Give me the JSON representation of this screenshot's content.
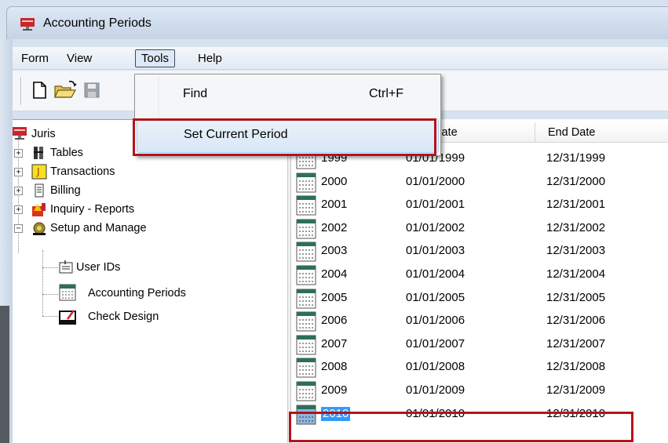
{
  "window": {
    "title": "Accounting Periods",
    "app_icon": "juris-app-icon"
  },
  "menubar": {
    "items": [
      {
        "label": "Form"
      },
      {
        "label": "View"
      },
      {
        "label": "Tools",
        "active": true
      },
      {
        "label": "Help"
      }
    ]
  },
  "toolbar": {
    "buttons": [
      {
        "icon": "new-document-icon"
      },
      {
        "icon": "open-folder-icon"
      },
      {
        "icon": "save-disk-icon",
        "disabled": true
      }
    ]
  },
  "tools_menu": {
    "items": [
      {
        "label": "Find",
        "shortcut": "Ctrl+F"
      },
      {
        "label": "Set Current Period",
        "shortcut": "",
        "highlighted": true
      }
    ]
  },
  "tree": {
    "root": "Juris",
    "nodes": [
      {
        "label": "Tables",
        "expander": "+"
      },
      {
        "label": "Transactions",
        "expander": "+"
      },
      {
        "label": "Billing",
        "expander": "+"
      },
      {
        "label": "Inquiry - Reports",
        "expander": "+"
      },
      {
        "label": "Setup and Manage",
        "expander": "−"
      }
    ],
    "children": [
      {
        "label": "User IDs"
      },
      {
        "label": "Accounting Periods"
      },
      {
        "label": "Check Design"
      }
    ]
  },
  "list": {
    "columns": [
      "Date",
      "End Date"
    ],
    "rows": [
      {
        "period": "1999",
        "start": "01/01/1999",
        "end": "12/31/1999"
      },
      {
        "period": "2000",
        "start": "01/01/2000",
        "end": "12/31/2000"
      },
      {
        "period": "2001",
        "start": "01/01/2001",
        "end": "12/31/2001"
      },
      {
        "period": "2002",
        "start": "01/01/2002",
        "end": "12/31/2002"
      },
      {
        "period": "2003",
        "start": "01/01/2003",
        "end": "12/31/2003"
      },
      {
        "period": "2004",
        "start": "01/01/2004",
        "end": "12/31/2004"
      },
      {
        "period": "2005",
        "start": "01/01/2005",
        "end": "12/31/2005"
      },
      {
        "period": "2006",
        "start": "01/01/2006",
        "end": "12/31/2006"
      },
      {
        "period": "2007",
        "start": "01/01/2007",
        "end": "12/31/2007"
      },
      {
        "period": "2008",
        "start": "01/01/2008",
        "end": "12/31/2008"
      },
      {
        "period": "2009",
        "start": "01/01/2009",
        "end": "12/31/2009"
      },
      {
        "period": "2010",
        "start": "01/01/2010",
        "end": "12/31/2010",
        "selected": true
      }
    ]
  },
  "colors": {
    "highlight_box": "#b3141b",
    "selection": "#3399ff"
  }
}
